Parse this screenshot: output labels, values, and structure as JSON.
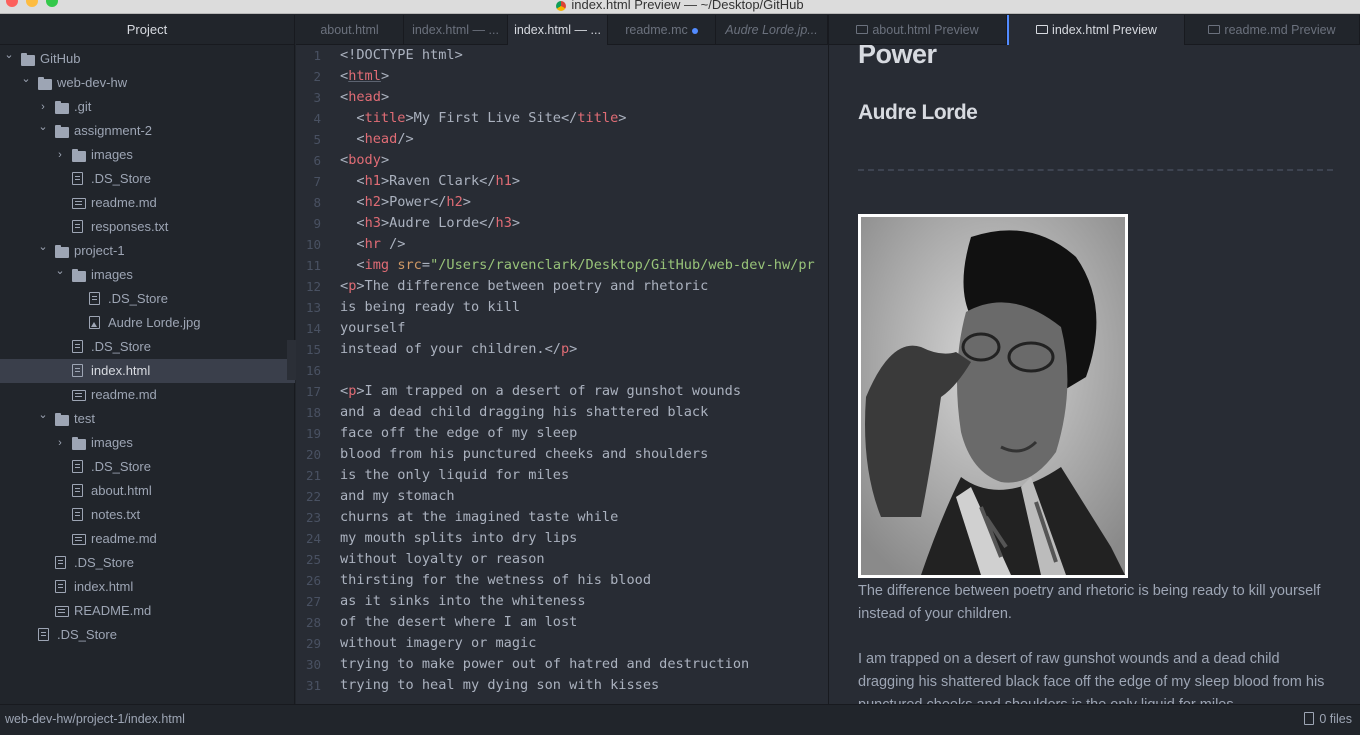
{
  "window": {
    "title": "index.html Preview — ~/Desktop/GitHub"
  },
  "tree": {
    "header": "Project",
    "items": [
      {
        "label": "GitHub",
        "type": "folder",
        "open": true,
        "depth": 0
      },
      {
        "label": "web-dev-hw",
        "type": "folder",
        "open": true,
        "depth": 1
      },
      {
        "label": ".git",
        "type": "folder",
        "open": false,
        "depth": 2
      },
      {
        "label": "assignment-2",
        "type": "folder",
        "open": true,
        "depth": 2
      },
      {
        "label": "images",
        "type": "folder",
        "open": false,
        "depth": 3
      },
      {
        "label": ".DS_Store",
        "type": "file",
        "depth": 3
      },
      {
        "label": "readme.md",
        "type": "md",
        "depth": 3
      },
      {
        "label": "responses.txt",
        "type": "file",
        "depth": 3
      },
      {
        "label": "project-1",
        "type": "folder",
        "open": true,
        "depth": 2
      },
      {
        "label": "images",
        "type": "folder",
        "open": true,
        "depth": 3
      },
      {
        "label": ".DS_Store",
        "type": "file",
        "depth": 4
      },
      {
        "label": "Audre Lorde.jpg",
        "type": "img",
        "depth": 4
      },
      {
        "label": ".DS_Store",
        "type": "file",
        "depth": 3
      },
      {
        "label": "index.html",
        "type": "file",
        "depth": 3,
        "selected": true
      },
      {
        "label": "readme.md",
        "type": "md",
        "depth": 3
      },
      {
        "label": "test",
        "type": "folder",
        "open": true,
        "depth": 2
      },
      {
        "label": "images",
        "type": "folder",
        "open": false,
        "depth": 3
      },
      {
        "label": ".DS_Store",
        "type": "file",
        "depth": 3
      },
      {
        "label": "about.html",
        "type": "file",
        "depth": 3
      },
      {
        "label": "notes.txt",
        "type": "file",
        "depth": 3
      },
      {
        "label": "readme.md",
        "type": "md",
        "depth": 3
      },
      {
        "label": ".DS_Store",
        "type": "file",
        "depth": 2
      },
      {
        "label": "index.html",
        "type": "file",
        "depth": 2
      },
      {
        "label": "README.md",
        "type": "md",
        "depth": 2
      },
      {
        "label": ".DS_Store",
        "type": "file",
        "depth": 1
      }
    ]
  },
  "tabs_left": [
    {
      "label": "about.html"
    },
    {
      "label": "index.html — ..."
    },
    {
      "label": "index.html — ...",
      "active": true
    },
    {
      "label": "readme.mc",
      "modified": true
    },
    {
      "label": "Audre Lorde.jp...",
      "italic": true
    }
  ],
  "tabs_right": [
    {
      "label": "about.html Preview"
    },
    {
      "label": "index.html Preview",
      "active": true
    },
    {
      "label": "readme.md Preview"
    }
  ],
  "editor": {
    "line_numbers": [
      "1",
      "2",
      "3",
      "4",
      "5",
      "6",
      "7",
      "8",
      "9",
      "10",
      "11",
      "12",
      "13",
      "14",
      "15",
      "16",
      "17",
      "18",
      "19",
      "20",
      "21",
      "22",
      "23",
      "24",
      "25",
      "26",
      "27",
      "28",
      "29",
      "30",
      "31"
    ],
    "lines": [
      [
        [
          "<!DOCTYPE html>",
          ""
        ]
      ],
      [
        [
          "<",
          ""
        ],
        [
          "html",
          "k"
        ],
        [
          ">",
          ""
        ]
      ],
      [
        [
          "<",
          ""
        ],
        [
          "head",
          "k"
        ],
        [
          ">",
          ""
        ]
      ],
      [
        [
          "  <",
          ""
        ],
        [
          "title",
          "k"
        ],
        [
          ">My First Live Site</",
          ""
        ],
        [
          "title",
          "k"
        ],
        [
          ">",
          ""
        ]
      ],
      [
        [
          "  <",
          ""
        ],
        [
          "head",
          "k"
        ],
        [
          "/>",
          ""
        ]
      ],
      [
        [
          "<",
          ""
        ],
        [
          "body",
          "k"
        ],
        [
          ">",
          ""
        ]
      ],
      [
        [
          "  <",
          ""
        ],
        [
          "h1",
          "k"
        ],
        [
          ">Raven Clark</",
          ""
        ],
        [
          "h1",
          "k"
        ],
        [
          ">",
          ""
        ]
      ],
      [
        [
          "  <",
          ""
        ],
        [
          "h2",
          "k"
        ],
        [
          ">Power</",
          ""
        ],
        [
          "h2",
          "k"
        ],
        [
          ">",
          ""
        ]
      ],
      [
        [
          "  <",
          ""
        ],
        [
          "h3",
          "k"
        ],
        [
          ">Audre Lorde</",
          ""
        ],
        [
          "h3",
          "k"
        ],
        [
          ">",
          ""
        ]
      ],
      [
        [
          "  <",
          ""
        ],
        [
          "hr",
          "k"
        ],
        [
          " />",
          ""
        ]
      ],
      [
        [
          "  <",
          ""
        ],
        [
          "img",
          "k"
        ],
        [
          " ",
          ""
        ],
        [
          "src",
          "a"
        ],
        [
          "=",
          ""
        ],
        [
          "\"/Users/ravenclark/Desktop/GitHub/web-dev-hw/pr",
          "s"
        ]
      ],
      [
        [
          "<",
          ""
        ],
        [
          "p",
          "k"
        ],
        [
          ">The difference between poetry and rhetoric",
          ""
        ]
      ],
      [
        [
          "is being ready to kill",
          ""
        ]
      ],
      [
        [
          "yourself",
          ""
        ]
      ],
      [
        [
          "instead of your children.</",
          ""
        ],
        [
          "p",
          "k"
        ],
        [
          ">",
          ""
        ]
      ],
      [
        [
          "",
          ""
        ]
      ],
      [
        [
          "<",
          ""
        ],
        [
          "p",
          "k"
        ],
        [
          ">I am trapped on a desert of raw gunshot wounds",
          ""
        ]
      ],
      [
        [
          "and a dead child dragging his shattered black",
          ""
        ]
      ],
      [
        [
          "face off the edge of my sleep",
          ""
        ]
      ],
      [
        [
          "blood from his punctured cheeks and shoulders",
          ""
        ]
      ],
      [
        [
          "is the only liquid for miles",
          ""
        ]
      ],
      [
        [
          "and my stomach",
          ""
        ]
      ],
      [
        [
          "churns at the imagined taste while",
          ""
        ]
      ],
      [
        [
          "my mouth splits into dry lips",
          ""
        ]
      ],
      [
        [
          "without loyalty or reason",
          ""
        ]
      ],
      [
        [
          "thirsting for the wetness of his blood",
          ""
        ]
      ],
      [
        [
          "as it sinks into the whiteness",
          ""
        ]
      ],
      [
        [
          "of the desert where I am lost",
          ""
        ]
      ],
      [
        [
          "without imagery or magic",
          ""
        ]
      ],
      [
        [
          "trying to make power out of hatred and destruction",
          ""
        ]
      ],
      [
        [
          "trying to heal my dying son with kisses",
          ""
        ]
      ]
    ]
  },
  "preview": {
    "h2": "Power",
    "h3": "Audre Lorde",
    "image_alt": "Audre Lorde.jpg",
    "p1": "The difference between poetry and rhetoric is being ready to kill yourself instead of your children.",
    "p2": "I am trapped on a desert of raw gunshot wounds and a dead child dragging his shattered black face off the edge of my sleep blood from his punctured cheeks and shoulders is the only liquid for miles"
  },
  "status": {
    "path": "web-dev-hw/project-1/index.html",
    "files": "0 files"
  },
  "colors": {
    "accent": "#528bff",
    "tag": "#e06c75",
    "string": "#98c379",
    "attr": "#d19a66"
  }
}
